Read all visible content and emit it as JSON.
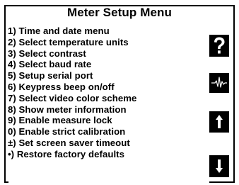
{
  "title": "Meter Setup Menu",
  "menu_items": [
    {
      "label": "1) Time and date menu"
    },
    {
      "label": "2) Select temperature units"
    },
    {
      "label": "3) Select contrast"
    },
    {
      "label": "4) Select baud rate"
    },
    {
      "label": "5) Setup serial port"
    },
    {
      "label": "6) Keypress beep on/off"
    },
    {
      "label": "7) Select video color scheme"
    },
    {
      "label": "8) Show meter information"
    },
    {
      "label": "9) Enable measure lock"
    },
    {
      "label": "0) Enable strict calibration"
    },
    {
      "label": "±) Set screen saver timeout"
    },
    {
      "label": "•) Restore factory defaults"
    }
  ],
  "side_buttons": [
    {
      "icon": "question-mark-icon"
    },
    {
      "icon": "signal-spark-icon"
    },
    {
      "icon": "up-arrow-icon"
    },
    {
      "icon": "down-arrow-icon"
    }
  ],
  "colors": {
    "foreground": "#000000",
    "background": "#ffffff"
  }
}
